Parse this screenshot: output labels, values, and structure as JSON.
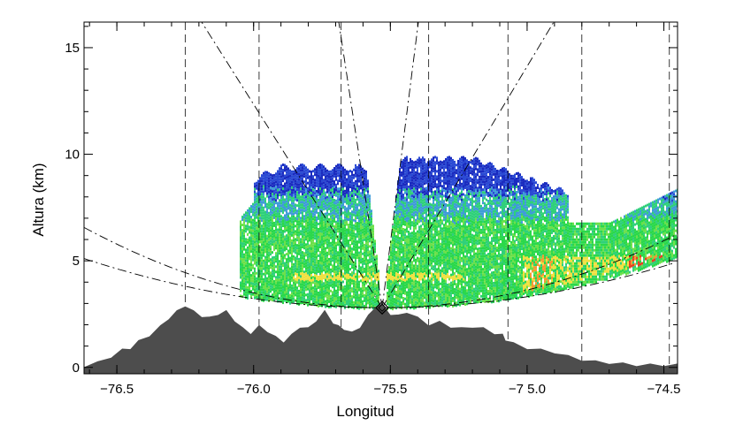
{
  "chart_data": {
    "type": "area",
    "title": "",
    "xlabel": "Longitud",
    "ylabel": "Altura (km)",
    "xlim": [
      -76.62,
      -74.45
    ],
    "ylim": [
      -0.3,
      16.2
    ],
    "x_ticks": [
      -76.5,
      -76.0,
      -75.5,
      -75.0,
      -74.5
    ],
    "x_tick_labels": [
      "−76.5",
      "−76.0",
      "−75.5",
      "−7 5.0",
      "−74.5"
    ],
    "y_ticks": [
      0,
      5,
      10,
      15
    ],
    "y_tick_labels": [
      "0",
      "5",
      "10",
      "15"
    ],
    "radar_site": {
      "lon": -75.53,
      "alt_km": 2.8
    },
    "series": [
      {
        "type": "area",
        "color": "#4d4d4d",
        "x": [
          -76.62,
          -76.57,
          -76.52,
          -76.48,
          -76.45,
          -76.42,
          -76.38,
          -76.34,
          -76.31,
          -76.28,
          -76.25,
          -76.22,
          -76.19,
          -76.16,
          -76.13,
          -76.1,
          -76.07,
          -76.04,
          -76.01,
          -75.98,
          -75.95,
          -75.92,
          -75.89,
          -75.86,
          -75.83,
          -75.8,
          -75.77,
          -75.74,
          -75.71,
          -75.69,
          -75.67,
          -75.64,
          -75.61,
          -75.58,
          -75.55,
          -75.53,
          -75.5,
          -75.47,
          -75.44,
          -75.4,
          -75.36,
          -75.32,
          -75.28,
          -75.24,
          -75.2,
          -75.16,
          -75.12,
          -75.09,
          -75.08,
          -75.05,
          -75.0,
          -74.95,
          -74.9,
          -74.85,
          -74.8,
          -74.75,
          -74.7,
          -74.65,
          -74.6,
          -74.55,
          -74.5,
          -74.45
        ],
        "y": [
          0.05,
          0.2,
          0.5,
          0.8,
          0.9,
          1.2,
          1.5,
          1.9,
          2.3,
          2.6,
          2.9,
          2.6,
          2.4,
          2.3,
          2.5,
          2.6,
          2.2,
          1.8,
          1.6,
          1.9,
          1.7,
          1.4,
          1.2,
          1.5,
          1.9,
          1.8,
          2.2,
          2.6,
          2.1,
          1.9,
          1.8,
          1.6,
          1.9,
          2.4,
          2.9,
          2.9,
          2.5,
          2.4,
          2.6,
          2.3,
          2.0,
          2.1,
          1.9,
          1.8,
          1.9,
          1.8,
          1.6,
          1.5,
          1.3,
          1.1,
          0.9,
          0.8,
          0.7,
          0.5,
          0.35,
          0.25,
          0.2,
          0.15,
          0.1,
          0.1,
          0.1,
          0.1
        ]
      }
    ],
    "scan_cone": {
      "left_lon": [
        -76.05,
        -75.59
      ],
      "right_lon": [
        -75.46,
        -74.45
      ],
      "alt_range_km": [
        2.8,
        10.3
      ],
      "colorscale": [
        "#1a2bbf",
        "#2a4ad4",
        "#3f9bd8",
        "#2fd07a",
        "#2ad84a",
        "#6de04a",
        "#f0e040",
        "#f59a30",
        "#e84020"
      ]
    },
    "reference_lines": {
      "vertical_lons": [
        -76.25,
        -75.98,
        -75.68,
        -75.36,
        -75.07,
        -74.8,
        -74.48
      ],
      "radial_lines_from_site": 4,
      "elevation_curves": 2
    }
  }
}
